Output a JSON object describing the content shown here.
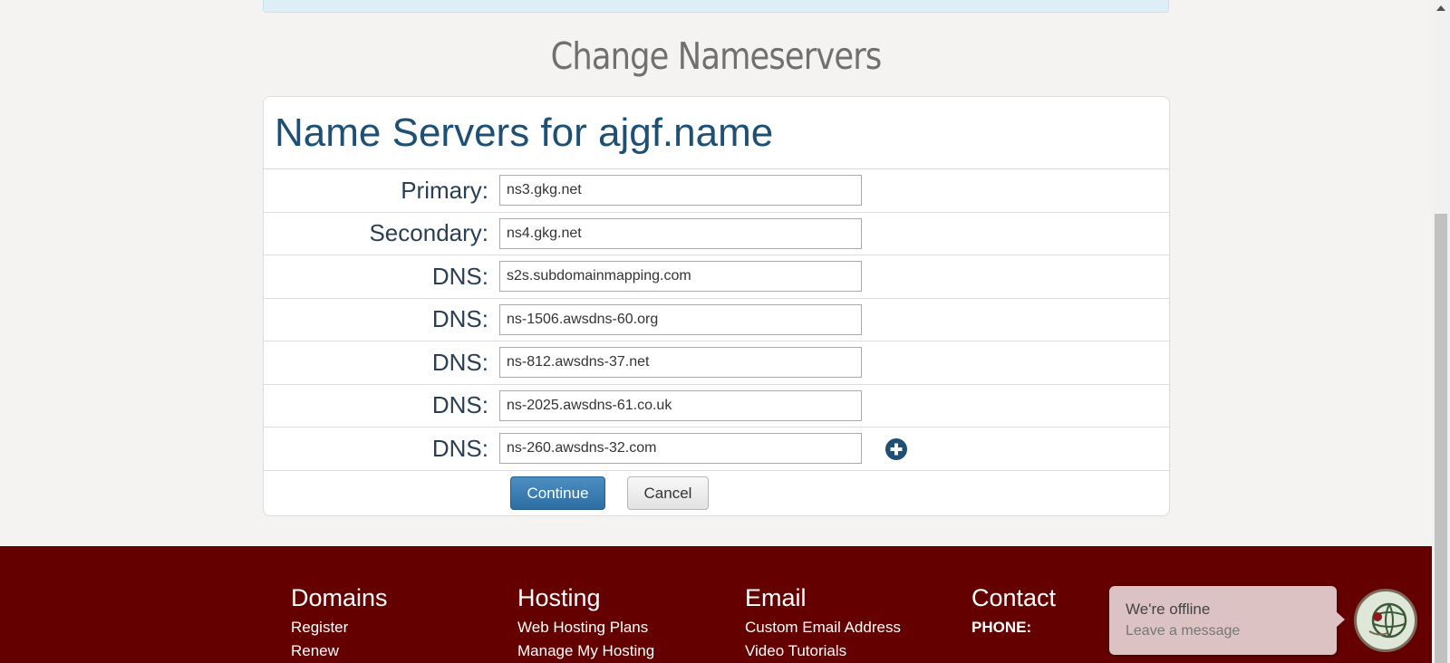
{
  "page_title": "Change Nameservers",
  "card": {
    "heading": "Name Servers for ajgf.name",
    "rows": [
      {
        "label": "Primary:",
        "value": "ns3.gkg.net"
      },
      {
        "label": "Secondary:",
        "value": "ns4.gkg.net"
      },
      {
        "label": "DNS:",
        "value": "s2s.subdomainmapping.com"
      },
      {
        "label": "DNS:",
        "value": "ns-1506.awsdns-60.org"
      },
      {
        "label": "DNS:",
        "value": "ns-812.awsdns-37.net"
      },
      {
        "label": "DNS:",
        "value": "ns-2025.awsdns-61.co.uk"
      },
      {
        "label": "DNS:",
        "value": "ns-260.awsdns-32.com"
      }
    ],
    "add_icon": "plus-circle-icon",
    "continue_label": "Continue",
    "cancel_label": "Cancel"
  },
  "footer": {
    "columns": [
      {
        "heading": "Domains",
        "links": [
          "Register",
          "Renew"
        ]
      },
      {
        "heading": "Hosting",
        "links": [
          "Web Hosting Plans",
          "Manage My Hosting"
        ]
      },
      {
        "heading": "Email",
        "links": [
          "Custom Email Address",
          "Video Tutorials"
        ]
      },
      {
        "heading": "Contact",
        "links": [
          "PHONE:"
        ]
      }
    ]
  },
  "chat": {
    "status": "We're offline",
    "prompt": "Leave a message",
    "avatar_icon": "globe-icon"
  },
  "colors": {
    "heading_blue": "#1e4f74",
    "footer_bg": "#640000",
    "button_blue": "#2d6ea3"
  }
}
